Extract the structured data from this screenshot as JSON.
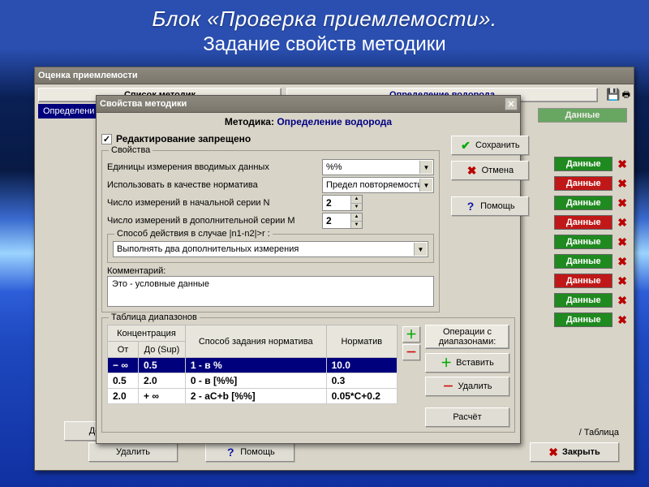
{
  "slide": {
    "title1": "Блок «Проверка приемлемости».",
    "title2": "Задание свойств методики"
  },
  "main_window": {
    "title": "Оценка приемлемости",
    "list_label": "Список методик",
    "right_label": "Определение водорода",
    "selected_method": "Определени",
    "data_tab_top": "Данные",
    "data_tabs": [
      "Данные",
      "Данные",
      "Данные",
      "Данные",
      "Данные",
      "Данные",
      "Данные",
      "Данные",
      "Данные"
    ],
    "tab_colors": [
      "green",
      "red",
      "green",
      "red",
      "green",
      "green",
      "red",
      "green",
      "green"
    ],
    "footer": {
      "add": "Добавить",
      "delete": "Удалить",
      "help": "Помощь",
      "close": "Закрыть",
      "ranges_tab": "/ Таблица"
    }
  },
  "dialog": {
    "title": "Свойства методики",
    "header_prefix": "Методика: ",
    "header_method": "Определение водорода",
    "readonly_label": "Редактирование запрещено",
    "readonly_checked": true,
    "props_group": "Свойства",
    "units_label": "Единицы измерения вводимых данных",
    "units_value": "%%",
    "norm_label": "Использовать в качестве норматива",
    "norm_value": "Предел повторяемости r",
    "n_label": "Число измерений в начальной серии N",
    "n_value": "2",
    "m_label": "Число измерений в дополнительной серии M",
    "m_value": "2",
    "action_group": "Способ действия в случае |n1-n2|>r :",
    "action_value": "Выполнять два дополнительных измерения",
    "comment_label": "Комментарий:",
    "comment_text": "Это - условные данные",
    "save": "Сохранить",
    "cancel": "Отмена",
    "help": "Помощь",
    "table_group": "Таблица диапазонов",
    "col_conc": "Концентрация",
    "col_from": "От",
    "col_to": "До (Sup)",
    "col_mode": "Способ задания норматива",
    "col_norm": "Норматив",
    "rows": [
      {
        "from": "− ∞",
        "to": "0.5",
        "mode": "1 - в %",
        "norm": "10.0",
        "selected": true
      },
      {
        "from": "0.5",
        "to": "2.0",
        "mode": "0 - в [%%]",
        "norm": "0.3",
        "selected": false
      },
      {
        "from": "2.0",
        "to": "+ ∞",
        "mode": "2 - aC+b [%%]",
        "norm": "0.05*C+0.2",
        "selected": false
      }
    ],
    "ops_group": "Операции с диапазонами:",
    "insert": "Вставить",
    "remove": "Удалить",
    "calc": "Расчёт"
  }
}
